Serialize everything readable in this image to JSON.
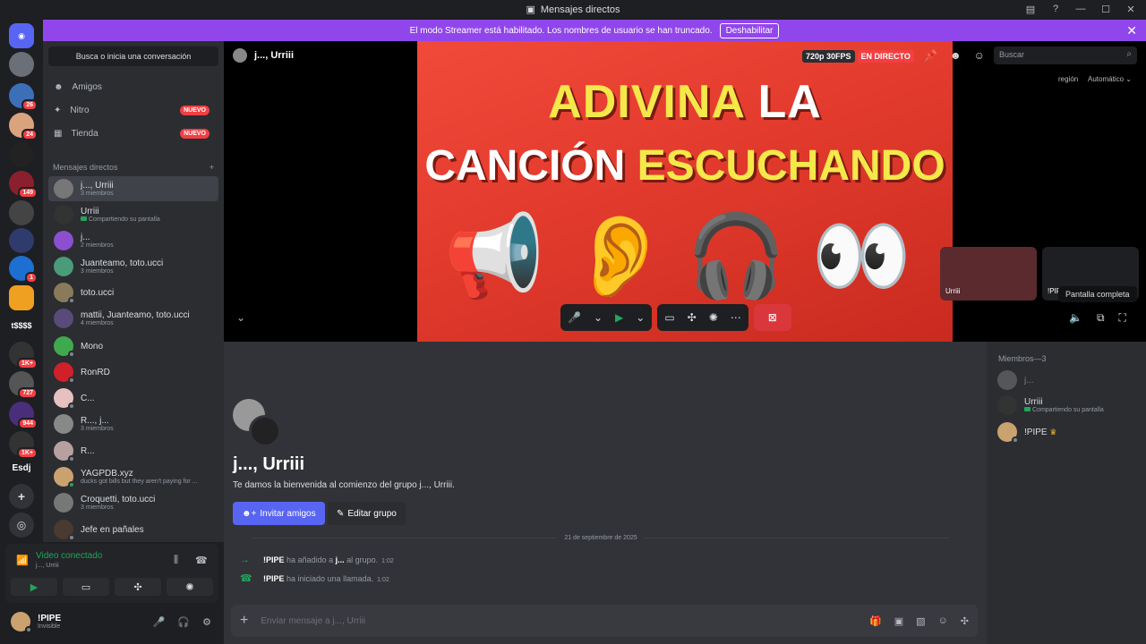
{
  "window": {
    "title": "Mensajes directos"
  },
  "banner": {
    "text": "El modo Streamer está habilitado. Los nombres de usuario se han truncado.",
    "button": "Deshabilitar"
  },
  "rail": {
    "badges": [
      "26",
      "24",
      "149",
      "1",
      "1K+",
      "727",
      "944",
      "1K+"
    ],
    "text_servers": [
      "t$$$$",
      "Esdj"
    ]
  },
  "sidebar": {
    "search": "Busca o inicia una conversación",
    "nav": [
      {
        "label": "Amigos",
        "badge": ""
      },
      {
        "label": "Nitro",
        "badge": "NUEVO"
      },
      {
        "label": "Tienda",
        "badge": "NUEVO"
      }
    ],
    "dm_header": "Mensajes directos",
    "dms": [
      {
        "name": "j..., Urriii",
        "sub": "3 miembros"
      },
      {
        "name": "Urriii",
        "sub": "Compartiendo su pantalla"
      },
      {
        "name": "j...",
        "sub": "2 miembros"
      },
      {
        "name": "Juanteamo, toto.ucci",
        "sub": "3 miembros"
      },
      {
        "name": "toto.ucci",
        "sub": ""
      },
      {
        "name": "mattii, Juanteamo, toto.ucci",
        "sub": "4 miembros"
      },
      {
        "name": "Mono",
        "sub": ""
      },
      {
        "name": "RonRD",
        "sub": ""
      },
      {
        "name": "C...",
        "sub": ""
      },
      {
        "name": "R..., j...",
        "sub": "3 miembros"
      },
      {
        "name": "R...",
        "sub": ""
      },
      {
        "name": "YAGPDB.xyz",
        "sub": "ducks got bills but they aren't paying for ..."
      },
      {
        "name": "Croquetti, toto.ucci",
        "sub": "3 miembros"
      },
      {
        "name": "Jefe en pañales",
        "sub": ""
      }
    ]
  },
  "voice": {
    "status": "Video conectado",
    "channel": "j..., Urriii"
  },
  "user": {
    "name": "!PIPE",
    "status": "Invisible"
  },
  "stage": {
    "header": "j..., Urriii",
    "quality": "720p 30FPS",
    "live": "EN DIRECTO",
    "search_placeholder": "Buscar",
    "region": "región",
    "auto": "Automático",
    "tile1": "Urriii",
    "tile2": "!PIPE",
    "tooltip": "Pantalla completa",
    "video_line1a": "ADIVINA",
    "video_line1b": "LA",
    "video_line2a": "CANCIÓN",
    "video_line2b": "ESCUCHANDO"
  },
  "chat": {
    "title": "j..., Urriii",
    "welcome": "Te damos la bienvenida al comienzo del grupo j..., Urriii.",
    "invite": "Invitar amigos",
    "edit": "Editar grupo",
    "date": "21 de septiembre de 2025",
    "messages": [
      {
        "user": "!PIPE",
        "text": "ha añadido a",
        "target": "j...",
        "suffix": "al grupo.",
        "time": "1:02"
      },
      {
        "user": "!PIPE",
        "text": "ha iniciado una llamada.",
        "target": "",
        "suffix": "",
        "time": "1:02"
      }
    ],
    "placeholder": "Enviar mensaje a j..., Urriii"
  },
  "members": {
    "header": "Miembros—3",
    "list": [
      {
        "name": "j...",
        "sub": ""
      },
      {
        "name": "Urriii",
        "sub": "Compartiendo su pantalla"
      },
      {
        "name": "!PIPE",
        "sub": ""
      }
    ]
  },
  "colors": {
    "accent": "#5865f2",
    "banner": "#9146ec",
    "live": "#f23f43",
    "online": "#23a55a"
  }
}
